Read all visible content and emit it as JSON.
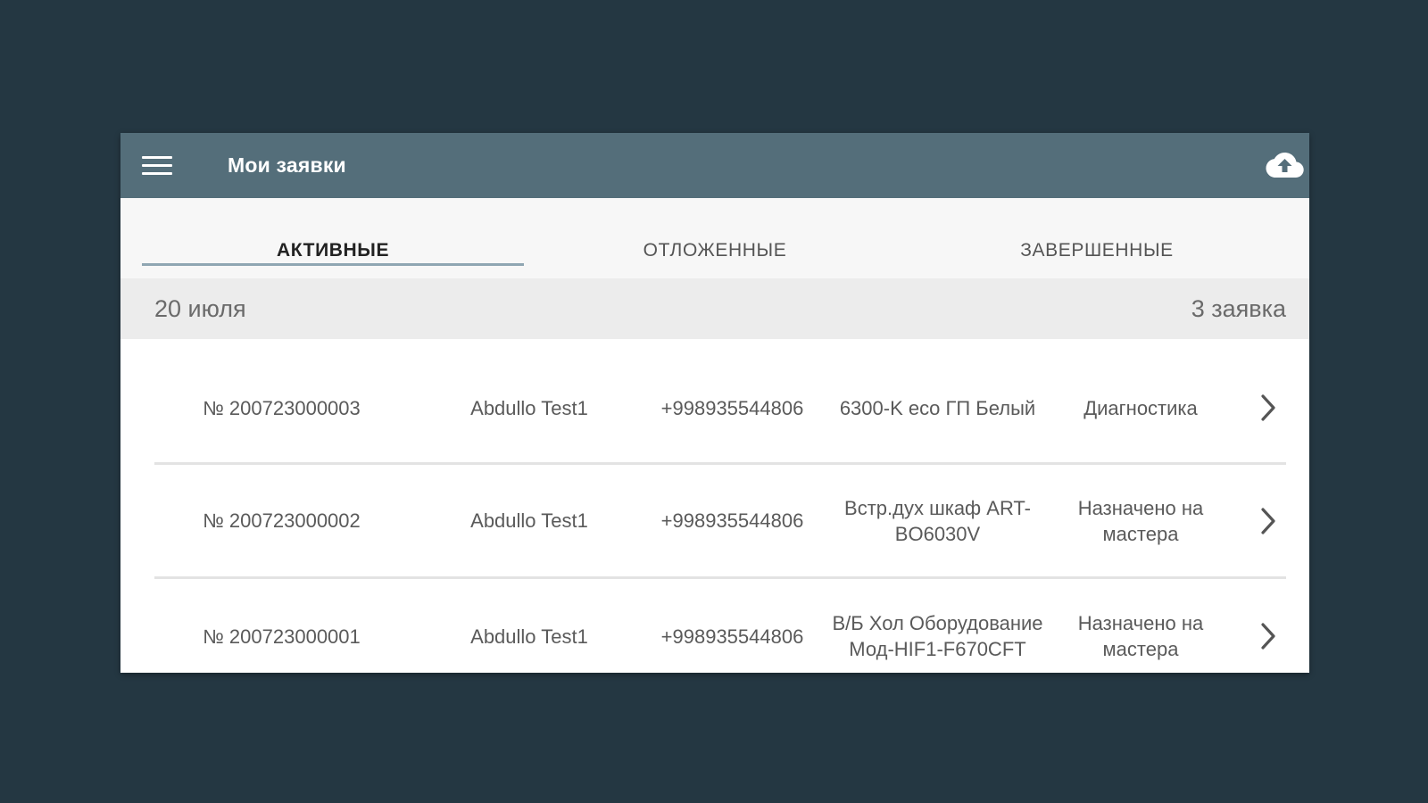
{
  "appbar": {
    "menu_icon": "hamburger-menu-icon",
    "title": "Мои заявки",
    "upload_icon": "cloud-upload-icon"
  },
  "tabs": [
    {
      "label": "АКТИВНЫЕ",
      "active": true
    },
    {
      "label": "ОТЛОЖЕННЫЕ",
      "active": false
    },
    {
      "label": "ЗАВЕРШЕННЫЕ",
      "active": false
    }
  ],
  "group": {
    "date": "20 июля",
    "count": "3 заявка"
  },
  "orders": [
    {
      "number": "№ 200723000003",
      "customer": "Abdullo Test1",
      "phone": "+998935544806",
      "product": "6300-K eco ГП Белый",
      "status": "Диагностика"
    },
    {
      "number": "№ 200723000002",
      "customer": "Abdullo Test1",
      "phone": "+998935544806",
      "product": "Встр.дух шкаф ART-BO6030V",
      "status": "Назначено на мастера"
    },
    {
      "number": "№ 200723000001",
      "customer": "Abdullo Test1",
      "phone": "+998935544806",
      "product": "В/Б Хол Оборудование Мод-HIF1-F670CFT",
      "status": "Назначено на мастера"
    }
  ],
  "colors": {
    "background": "#243742",
    "appbar": "#546e7a",
    "tab_indicator": "#8fa6b2"
  }
}
